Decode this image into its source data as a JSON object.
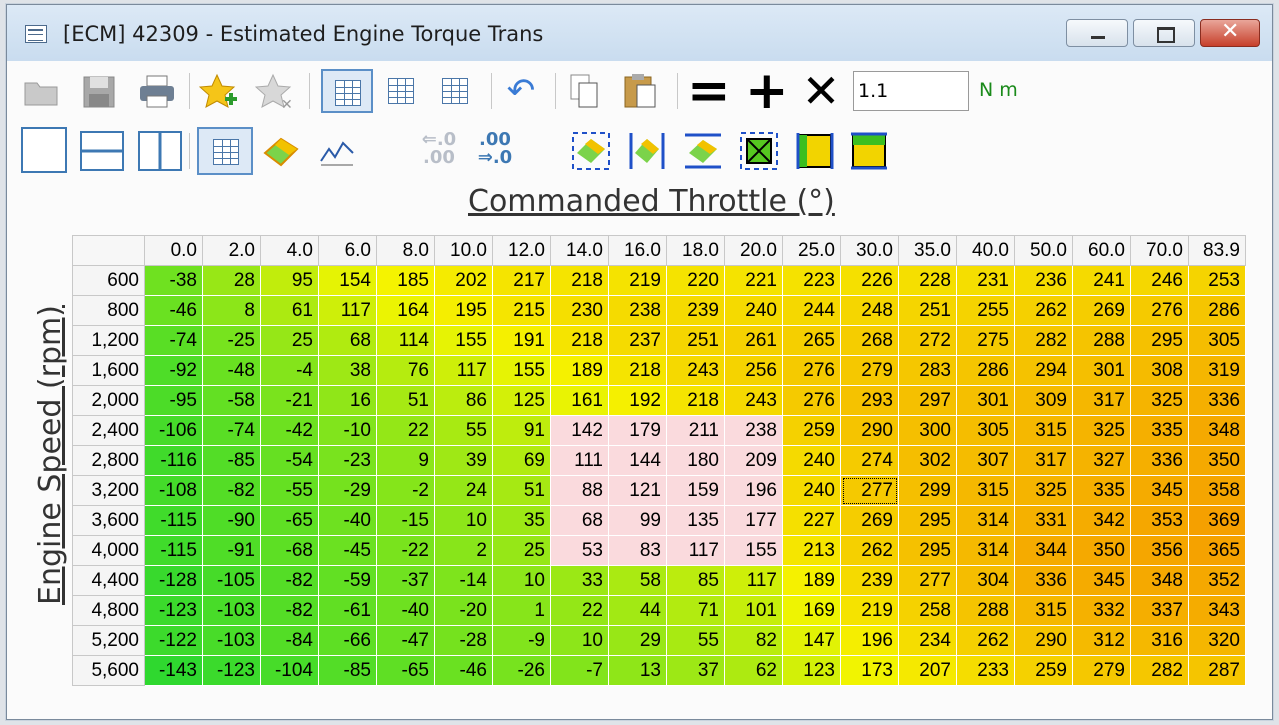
{
  "window": {
    "title": "[ECM] 42309 - Estimated Engine Torque Trans",
    "minimize_icon": "minimize-icon",
    "maximize_icon": "restore-icon",
    "close_icon": "close-icon"
  },
  "toolbar1": {
    "value_input": "1.1",
    "unit": "N m",
    "colors": {
      "minus": "#000000",
      "plus": "#000000",
      "times": "#000000"
    }
  },
  "toolbar2": {
    "decimal_down": "⇐.0\n.00",
    "decimal_up": ".00\n⇒.0"
  },
  "table": {
    "x_title": "Commanded Throttle (°)",
    "y_title": "Engine Speed (rpm)",
    "columns": [
      "0.0",
      "2.0",
      "4.0",
      "6.0",
      "8.0",
      "10.0",
      "12.0",
      "14.0",
      "16.0",
      "18.0",
      "20.0",
      "25.0",
      "30.0",
      "35.0",
      "40.0",
      "50.0",
      "60.0",
      "70.0",
      "83.9"
    ],
    "rows": [
      {
        "rpm": "600",
        "values": [
          "-38",
          "28",
          "95",
          "154",
          "185",
          "202",
          "217",
          "218",
          "219",
          "220",
          "221",
          "223",
          "226",
          "228",
          "231",
          "236",
          "241",
          "246",
          "253"
        ]
      },
      {
        "rpm": "800",
        "values": [
          "-46",
          "8",
          "61",
          "117",
          "164",
          "195",
          "215",
          "230",
          "238",
          "239",
          "240",
          "244",
          "248",
          "251",
          "255",
          "262",
          "269",
          "276",
          "286"
        ]
      },
      {
        "rpm": "1,200",
        "values": [
          "-74",
          "-25",
          "25",
          "68",
          "114",
          "155",
          "191",
          "218",
          "237",
          "251",
          "261",
          "265",
          "268",
          "272",
          "275",
          "282",
          "288",
          "295",
          "305"
        ]
      },
      {
        "rpm": "1,600",
        "values": [
          "-92",
          "-48",
          "-4",
          "38",
          "76",
          "117",
          "155",
          "189",
          "218",
          "243",
          "256",
          "276",
          "279",
          "283",
          "286",
          "294",
          "301",
          "308",
          "319"
        ]
      },
      {
        "rpm": "2,000",
        "values": [
          "-95",
          "-58",
          "-21",
          "16",
          "51",
          "86",
          "125",
          "161",
          "192",
          "218",
          "243",
          "276",
          "293",
          "297",
          "301",
          "309",
          "317",
          "325",
          "336"
        ]
      },
      {
        "rpm": "2,400",
        "values": [
          "-106",
          "-74",
          "-42",
          "-10",
          "22",
          "55",
          "91",
          "142",
          "179",
          "211",
          "238",
          "259",
          "290",
          "300",
          "305",
          "315",
          "325",
          "335",
          "348"
        ]
      },
      {
        "rpm": "2,800",
        "values": [
          "-116",
          "-85",
          "-54",
          "-23",
          "9",
          "39",
          "69",
          "111",
          "144",
          "180",
          "209",
          "240",
          "274",
          "302",
          "307",
          "317",
          "327",
          "336",
          "350"
        ]
      },
      {
        "rpm": "3,200",
        "values": [
          "-108",
          "-82",
          "-55",
          "-29",
          "-2",
          "24",
          "51",
          "88",
          "121",
          "159",
          "196",
          "240",
          "277",
          "299",
          "315",
          "325",
          "335",
          "345",
          "358"
        ]
      },
      {
        "rpm": "3,600",
        "values": [
          "-115",
          "-90",
          "-65",
          "-40",
          "-15",
          "10",
          "35",
          "68",
          "99",
          "135",
          "177",
          "227",
          "269",
          "295",
          "314",
          "331",
          "342",
          "353",
          "369"
        ]
      },
      {
        "rpm": "4,000",
        "values": [
          "-115",
          "-91",
          "-68",
          "-45",
          "-22",
          "2",
          "25",
          "53",
          "83",
          "117",
          "155",
          "213",
          "262",
          "295",
          "314",
          "344",
          "350",
          "356",
          "365"
        ]
      },
      {
        "rpm": "4,400",
        "values": [
          "-128",
          "-105",
          "-82",
          "-59",
          "-37",
          "-14",
          "10",
          "33",
          "58",
          "85",
          "117",
          "189",
          "239",
          "277",
          "304",
          "336",
          "345",
          "348",
          "352"
        ]
      },
      {
        "rpm": "4,800",
        "values": [
          "-123",
          "-103",
          "-82",
          "-61",
          "-40",
          "-20",
          "1",
          "22",
          "44",
          "71",
          "101",
          "169",
          "219",
          "258",
          "288",
          "315",
          "332",
          "337",
          "343"
        ]
      },
      {
        "rpm": "5,200",
        "values": [
          "-122",
          "-103",
          "-84",
          "-66",
          "-47",
          "-28",
          "-9",
          "10",
          "29",
          "55",
          "82",
          "147",
          "196",
          "234",
          "262",
          "290",
          "312",
          "316",
          "320"
        ]
      },
      {
        "rpm": "5,600",
        "values": [
          "-143",
          "-123",
          "-104",
          "-85",
          "-65",
          "-46",
          "-26",
          "-7",
          "13",
          "37",
          "62",
          "123",
          "173",
          "207",
          "233",
          "259",
          "279",
          "282",
          "287"
        ]
      }
    ],
    "selected_cell": {
      "row": 7,
      "col": 12
    },
    "highlight_region": {
      "rows": [
        5,
        9
      ],
      "cols": [
        7,
        10
      ],
      "color": "#fadadd"
    },
    "color_scale": {
      "low": "#2fd82f",
      "mid": "#f5f500",
      "high": "#f5a000"
    }
  }
}
